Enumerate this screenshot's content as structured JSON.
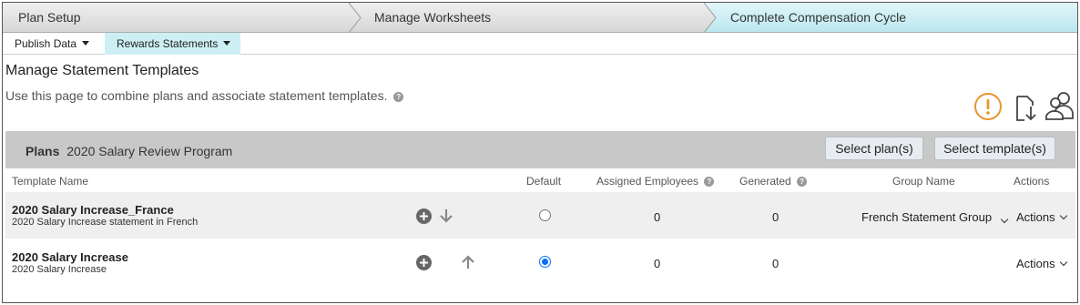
{
  "stepper": {
    "steps": [
      {
        "label": "Plan Setup"
      },
      {
        "label": "Manage Worksheets"
      },
      {
        "label": "Complete Compensation Cycle"
      }
    ]
  },
  "subtabs": [
    {
      "label": "Publish Data"
    },
    {
      "label": "Rewards Statements"
    }
  ],
  "page": {
    "title": "Manage Statement Templates",
    "description": "Use this page to combine plans and associate statement templates.",
    "help_glyph": "?"
  },
  "toolbar_icons": [
    "warning-icon",
    "download-document-icon",
    "users-icon"
  ],
  "plans": {
    "label": "Plans",
    "program": "2020 Salary Review Program",
    "select_plans": "Select plan(s)",
    "select_templates": "Select template(s)"
  },
  "table": {
    "headers": {
      "template_name": "Template Name",
      "default": "Default",
      "assigned": "Assigned Employees",
      "generated": "Generated",
      "group_name": "Group Name",
      "actions": "Actions"
    },
    "rows": [
      {
        "name": "2020 Salary Increase_France",
        "subtitle": "2020 Salary Increase statement in French",
        "default": false,
        "assigned": "0",
        "generated": "0",
        "group_name": "French Statement Group",
        "actions": "Actions"
      },
      {
        "name": "2020 Salary Increase",
        "subtitle": "2020 Salary Increase",
        "default": true,
        "assigned": "0",
        "generated": "0",
        "group_name": "",
        "actions": "Actions"
      }
    ]
  },
  "colors": {
    "step_active": "#cdeff4",
    "step_inactive": "#e2e2e2",
    "subtab_active": "#cdeff4",
    "warning": "#e8952c",
    "plans_bar": "#c8c8c8"
  }
}
